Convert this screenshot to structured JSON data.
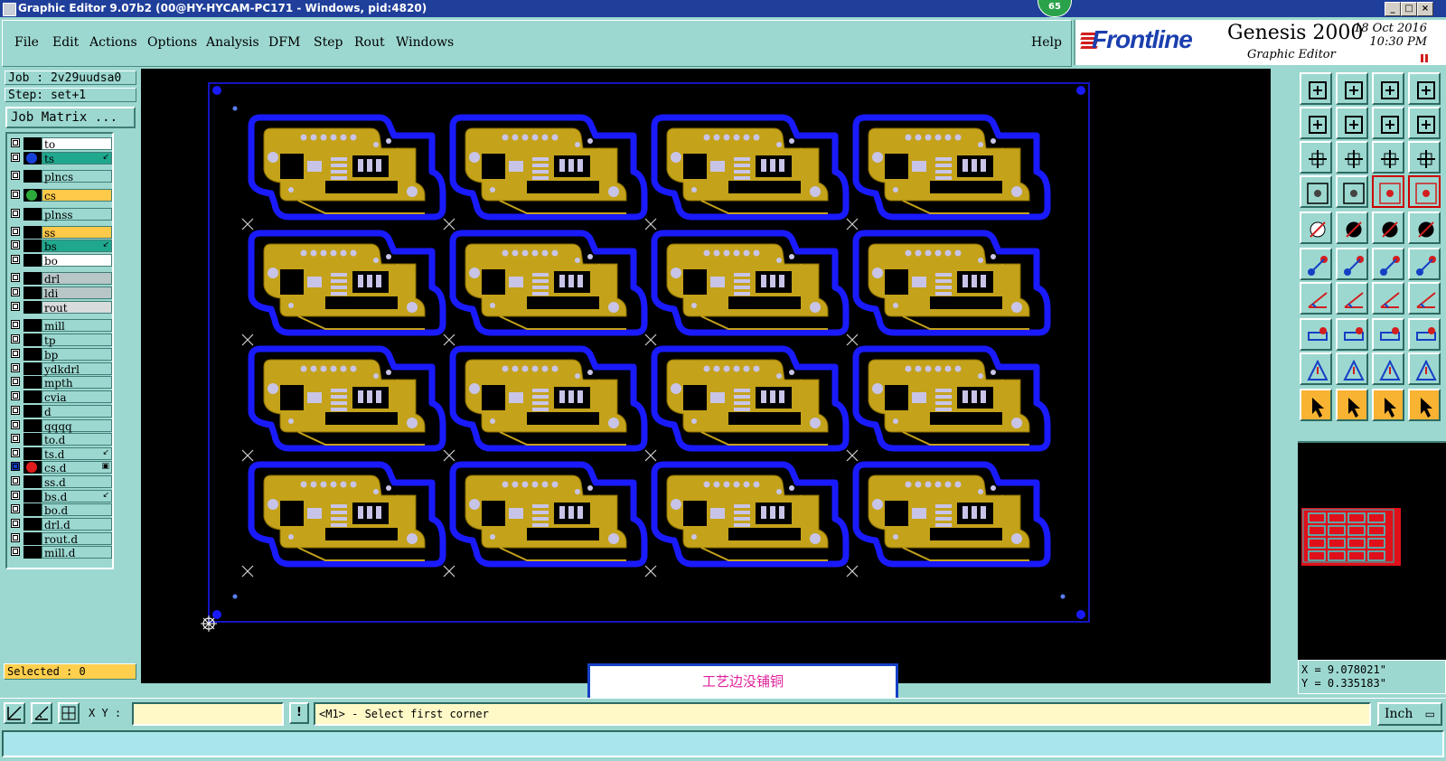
{
  "window": {
    "title": "Graphic Editor 9.07b2 (00@HY-HYCAM-PC171 - Windows, pid:4820)",
    "badge": "65",
    "controls": [
      "_",
      "□",
      "×"
    ]
  },
  "menu": [
    "File",
    "Edit",
    "Actions",
    "Options",
    "Analysis",
    "DFM",
    "Step",
    "Rout",
    "Windows"
  ],
  "help": "Help",
  "brand": {
    "logo": "Frontline",
    "product": "Genesis 2000",
    "subtitle": "Graphic Editor",
    "date": "18 Oct 2016",
    "time": "10:30 PM"
  },
  "job": {
    "job_line": "Job : 2v29uudsa0",
    "step_line": "Step: set+1",
    "matrix_button": "Job Matrix ..."
  },
  "layers": [
    {
      "name": "to",
      "bg": "#ffffff",
      "dot": ""
    },
    {
      "name": "ts",
      "bg": "#1fa88e",
      "dot": "#1540d8",
      "mark": "↙"
    },
    {
      "name": "plncs",
      "bg": "#9cd8d0",
      "dot": ""
    },
    {
      "name": "cs",
      "bg": "#ffc94a",
      "dot": "#2caa3a"
    },
    {
      "name": "plnss",
      "bg": "#9cd8d0",
      "dot": ""
    },
    {
      "name": "ss",
      "bg": "#ffc94a",
      "dot": ""
    },
    {
      "name": "bs",
      "bg": "#1fa88e",
      "dot": "",
      "mark": "↙"
    },
    {
      "name": "bo",
      "bg": "#ffffff",
      "dot": ""
    },
    {
      "name": "drl",
      "bg": "#b8c6c8",
      "dot": ""
    },
    {
      "name": "ldi",
      "bg": "#b8c6c8",
      "dot": ""
    },
    {
      "name": "rout",
      "bg": "#d8dcdc",
      "dot": ""
    },
    {
      "name": "mill",
      "bg": "#9cd8d0",
      "dot": ""
    },
    {
      "name": "tp",
      "bg": "#9cd8d0",
      "dot": ""
    },
    {
      "name": "bp",
      "bg": "#9cd8d0",
      "dot": ""
    },
    {
      "name": "ydkdrl",
      "bg": "#9cd8d0",
      "dot": ""
    },
    {
      "name": "mpth",
      "bg": "#9cd8d0",
      "dot": ""
    },
    {
      "name": "cvia",
      "bg": "#9cd8d0",
      "dot": ""
    },
    {
      "name": "d",
      "bg": "#9cd8d0",
      "dot": ""
    },
    {
      "name": "qqqq",
      "bg": "#9cd8d0",
      "dot": ""
    },
    {
      "name": "to.d",
      "bg": "#9cd8d0",
      "dot": ""
    },
    {
      "name": "ts.d",
      "bg": "#9cd8d0",
      "dot": "",
      "mark": "↙"
    },
    {
      "name": "cs.d",
      "bg": "#9cd8d0",
      "dot": "#e01c1c",
      "mark": "▣",
      "active": true
    },
    {
      "name": "ss.d",
      "bg": "#9cd8d0",
      "dot": ""
    },
    {
      "name": "bs.d",
      "bg": "#9cd8d0",
      "dot": "",
      "mark": "↙"
    },
    {
      "name": "bo.d",
      "bg": "#9cd8d0",
      "dot": ""
    },
    {
      "name": "drl.d",
      "bg": "#9cd8d0",
      "dot": ""
    },
    {
      "name": "rout.d",
      "bg": "#9cd8d0",
      "dot": ""
    },
    {
      "name": "mill.d",
      "bg": "#9cd8d0",
      "dot": ""
    }
  ],
  "selected": "Selected : 0",
  "annotation": "工艺边没铺铜",
  "panel": {
    "columns": 4,
    "rows": 4
  },
  "coords": {
    "x": "X = 9.078021\"",
    "y": "Y = 0.335183\""
  },
  "cmd": {
    "xy_label": "X Y :",
    "xy_value": "",
    "bang": "!",
    "prompt": "<M1> - Select first corner",
    "unit": "Inch"
  },
  "colors": {
    "copper": "#c4a21a",
    "solder": "#1a1aff",
    "pad": "#c8c4e8",
    "panel_bg": "#9cd8d0"
  },
  "toolbar_icons": [
    "zoom-home-icon",
    "zoom-fit-icon",
    "home-icon",
    "window-icon",
    "pan-left-icon",
    "pan-right-icon",
    "undo-view-icon",
    "redraw-icon",
    "zoom-in-icon",
    "zoom-out-icon",
    "scale-1-2-icon",
    "help-icon",
    "measure-icon",
    "grid-icon",
    "layers-red-icon",
    "layers-red-2-icon",
    "pad-icon",
    "surface-icon",
    "ruler-icon",
    "target-icon",
    "connect-icon",
    "cross-icon",
    "line-add-icon",
    "line-add-2-icon",
    "angle-icon",
    "diagonal-icon",
    "rotate-icon",
    "mirror-icon",
    "move-icon",
    "line-icon",
    "resize-icon",
    "copy-icon",
    "arc-icon",
    "arc-2-icon",
    "arc-3-icon",
    "arc-4-icon",
    "cursor-icon",
    "cursor-2-icon",
    "cursor-3-icon",
    "cursor-4-icon"
  ]
}
